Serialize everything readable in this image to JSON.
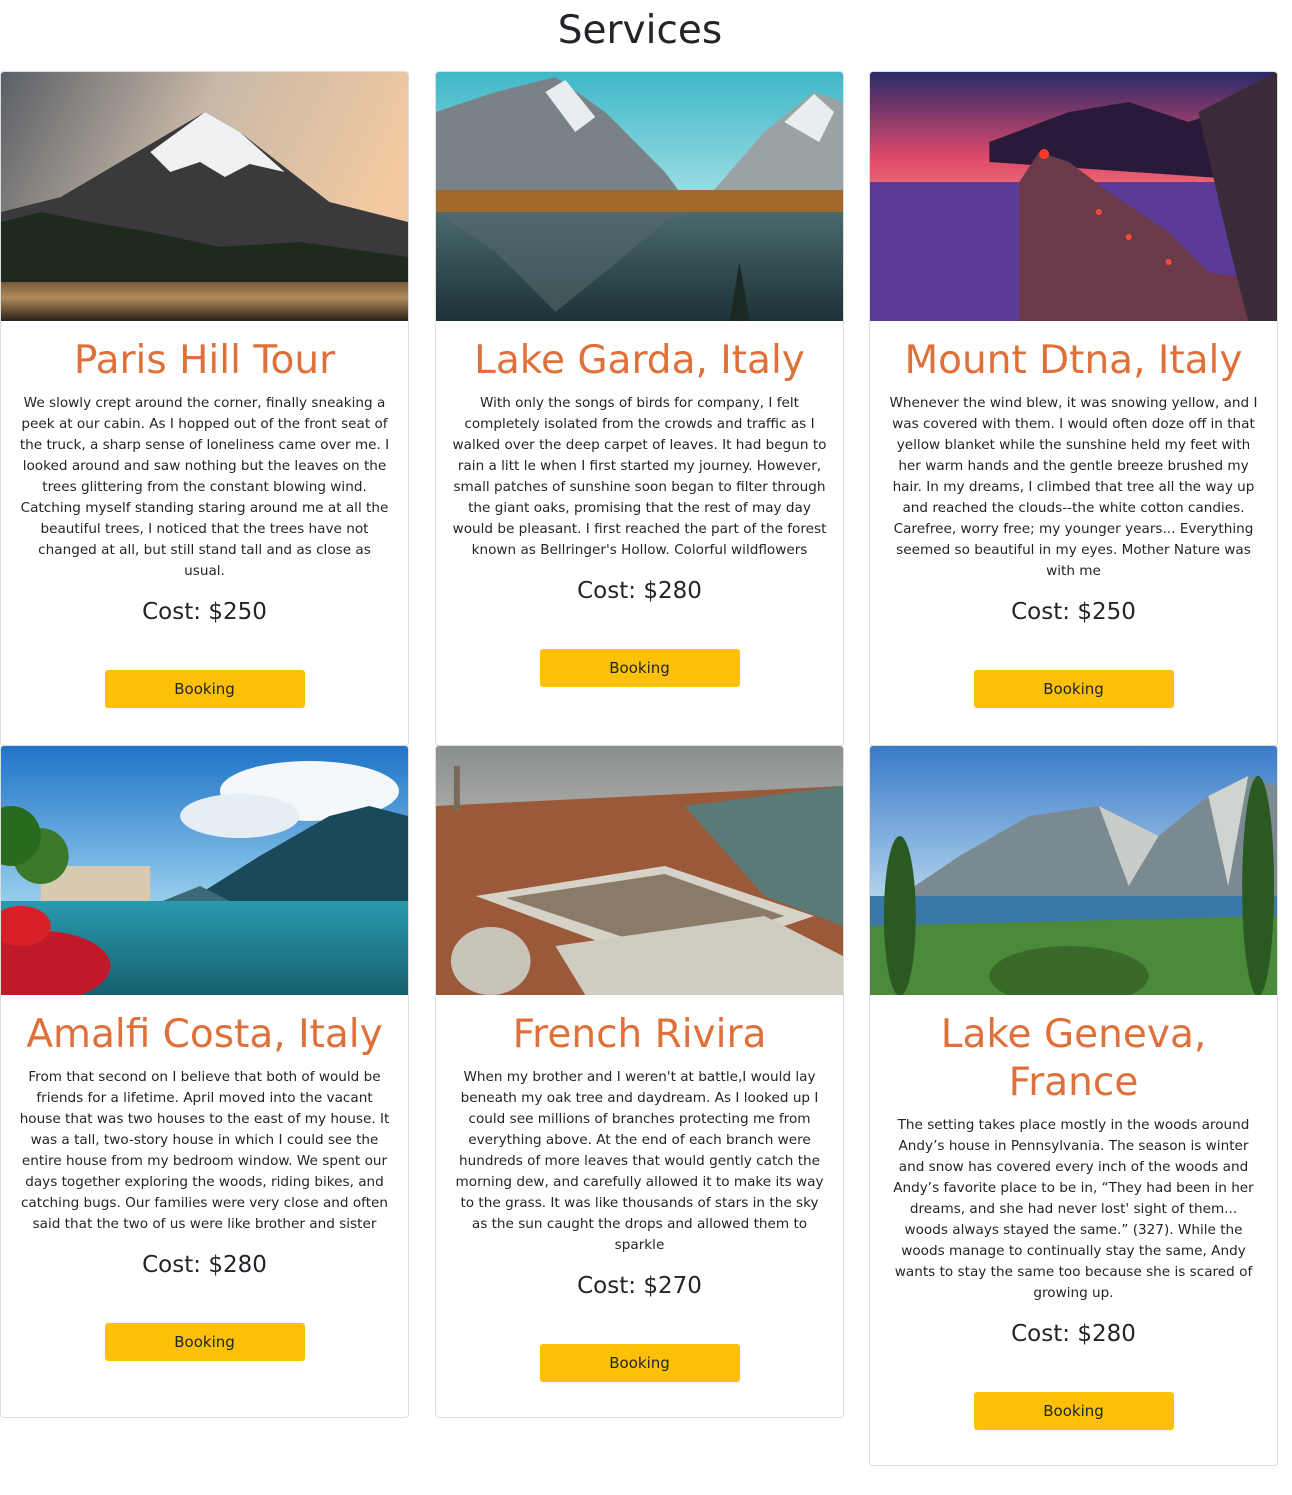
{
  "page": {
    "title": "Services"
  },
  "accent_color": "#e0703a",
  "button_color": "#fcc107",
  "cards": [
    {
      "title": "Paris Hill Tour",
      "image": "snow-mountain-lake-photo",
      "description": "We slowly crept around the corner, finally sneaking a peek at our cabin. As I hopped out of the front seat of the truck, a sharp sense of loneliness came over me. I looked around and saw nothing but the leaves on the trees glittering from the constant blowing wind. Catching myself standing staring around me at all the beautiful trees, I noticed that the trees have not changed at all, but still stand tall and as close as usual.",
      "cost": "Cost: $250",
      "button": "Booking"
    },
    {
      "title": "Lake Garda, Italy",
      "image": "alpine-lake-reflection-photo",
      "description": "With only the songs of birds for company, I felt completely isolated from the crowds and traffic as I walked over the deep carpet of leaves. It had begun to rain a litt le when I first started my journey. However, small patches of sunshine soon began to filter through the giant oaks, promising that the rest of may day would be pleasant. I first reached the part of the forest known as Bellringer's Hollow. Colorful wildflowers",
      "cost": "Cost: $280",
      "button": "Booking"
    },
    {
      "title": "Mount Dtna, Italy",
      "image": "coastal-village-sunset-photo",
      "description": "Whenever the wind blew, it was snowing yellow, and I was covered with them. I would often doze off in that yellow blanket while the sunshine held my feet with her warm hands and the gentle breeze brushed my hair. In my dreams, I climbed that tree all the way up and reached the clouds--the white cotton candies. Carefree, worry free; my younger years... Everything seemed so beautiful in my eyes. Mother Nature was with me",
      "cost": "Cost: $250",
      "button": "Booking"
    },
    {
      "title": "Amalfi Costa, Italy",
      "image": "lakeside-town-flowers-photo",
      "description": "From that second on I believe that both of would be friends for a lifetime. April moved into the vacant house that was two houses to the east of my house. It was a tall, two-story house in which I could see the entire house from my bedroom window. We spent our days together exploring the woods, riding bikes, and catching bugs. Our families were very close and often said that the two of us were like brother and sister",
      "cost": "Cost: $280",
      "button": "Booking"
    },
    {
      "title": "French Rivira",
      "image": "venice-rooftops-aerial-photo",
      "description": "When my brother and I weren't at battle,I would lay beneath my oak tree and daydream. As I looked up I could see millions of branches protecting me from everything above. At the end of each branch were hundreds of more leaves that would gently catch the morning dew, and carefully allowed it to make its way to the grass. It was like thousands of stars in the sky as the sun caught the drops and allowed them to sparkle",
      "cost": "Cost: $270",
      "button": "Booking"
    },
    {
      "title": "Lake Geneva, France",
      "image": "lake-mountains-cypress-photo",
      "description": "The setting takes place mostly in the woods around Andy’s house in Pennsylvania. The season is winter and snow has covered every inch of the woods and Andy’s favorite place to be in, “They had been in her dreams, and she had never lost' sight of them... woods always stayed the same.” (327). While the woods manage to continually stay the same, Andy wants to stay the same too because she is scared of growing up.",
      "cost": "Cost: $280",
      "button": "Booking"
    }
  ]
}
